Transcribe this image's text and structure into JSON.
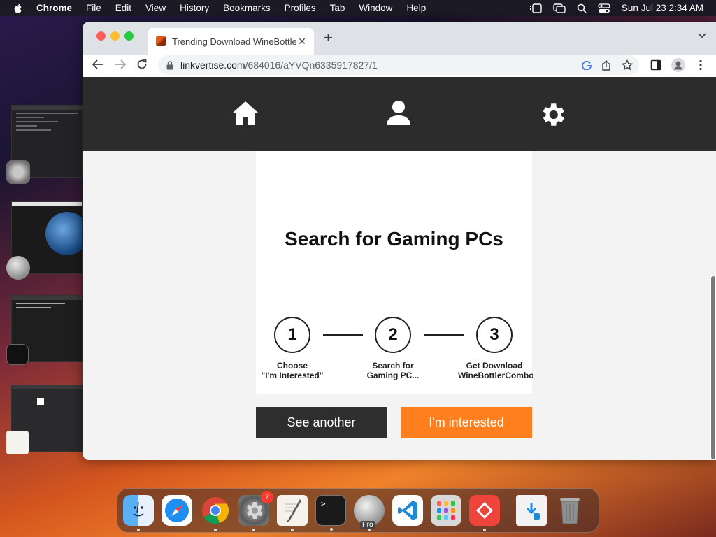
{
  "menubar": {
    "app_name": "Chrome",
    "items": [
      "File",
      "Edit",
      "View",
      "History",
      "Bookmarks",
      "Profiles",
      "Tab",
      "Window",
      "Help"
    ],
    "clock": "Sun Jul 23  2:34 AM"
  },
  "browser": {
    "tab_title": "Trending Download WineBottle",
    "url_host": "linkvertise.com",
    "url_path": "/684016/aYVQn6335917827/1"
  },
  "page": {
    "nav_icons": [
      "home-icon",
      "user-icon",
      "gear-icon"
    ],
    "headline": "Search for Gaming PCs",
    "steps": [
      {
        "number": "1",
        "label_line1": "Choose",
        "label_line2": "\"I'm Interested\""
      },
      {
        "number": "2",
        "label_line1": "Search for",
        "label_line2": "Gaming PC..."
      },
      {
        "number": "3",
        "label_line1": "Get Download",
        "label_line2": "WineBottlerCombo"
      }
    ],
    "see_another_label": "See another",
    "interested_label": "I'm interested"
  },
  "dock": {
    "apps": [
      "finder",
      "safari",
      "chrome",
      "system-settings",
      "textedit",
      "terminal",
      "google-earth-pro",
      "vscode",
      "launchpad",
      "anydesk",
      "downloads",
      "trash"
    ],
    "system_settings_badge": "2",
    "earth_pro_label": "Pro"
  },
  "colors": {
    "accent_orange": "#ff7f1e",
    "nav_dark": "#2c2c2c",
    "button_dark": "#2e2e2e"
  }
}
